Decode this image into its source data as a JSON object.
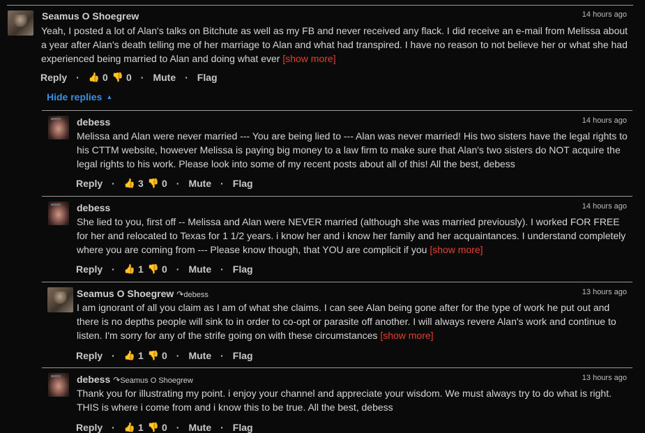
{
  "ui": {
    "reply": "Reply",
    "mute": "Mute",
    "flag": "Flag",
    "show_more": "[show more]",
    "hide_replies": "Hide replies",
    "sep": "·",
    "like_icon": "thumbs-up-icon",
    "dislike_icon": "thumbs-down-icon",
    "colors": {
      "background": "#0a0a0a",
      "link": "#3a8fe0",
      "show_more": "#e0422e"
    }
  },
  "comments": [
    {
      "author": "Seamus O Shoegrew",
      "time": "14 hours ago",
      "text": "Yeah, I posted a lot of Alan's talks on Bitchute as well as my FB and never received any flack. I did receive an e-mail from Melissa about a year after Alan's death telling me of her marriage to Alan and what had transpired. I have no reason to not believe her or what she had experienced being married to Alan and doing what ever",
      "likes": "0",
      "dislikes": "0"
    },
    {
      "author": "debess",
      "time": "14 hours ago",
      "text": "Melissa and Alan were never married --- You are being lied to --- Alan was never married! His two sisters have the legal rights to his CTTM website, however Melissa is paying big money to a law firm to make sure that Alan's two sisters do NOT acquire the legal rights to his work. Please look into some of my recent posts about all of this! All the best, debess",
      "likes": "3",
      "dislikes": "0"
    },
    {
      "author": "debess",
      "time": "14 hours ago",
      "text": "She lied to you, first off -- Melissa and Alan were NEVER married (although she was married previously). I worked FOR FREE for her and relocated to Texas for 1 1/2 years. i know her and i know her family and her acquaintances. I understand completely where you are coming from --- Please know though, that YOU are complicit if you",
      "likes": "1",
      "dislikes": "0"
    },
    {
      "author": "Seamus O Shoegrew",
      "reply_to": "debess",
      "time": "13 hours ago",
      "text": "I am ignorant of all you claim as I am of what she claims. I can see Alan being gone after for the type of work he put out and there is no depths people will sink to in order to co-opt or parasite off another. I will always revere Alan's work and continue to listen. I'm sorry for any of the strife going on with these circumstances",
      "likes": "1",
      "dislikes": "0"
    },
    {
      "author": "debess",
      "reply_to": "Seamus O Shoegrew",
      "time": "13 hours ago",
      "text": "Thank you for illustrating my point. i enjoy your channel and appreciate your wisdom. We must always try to do what is right. THIS is where i come from and i know this to be true. All the best, debess",
      "likes": "1",
      "dislikes": "0"
    }
  ]
}
